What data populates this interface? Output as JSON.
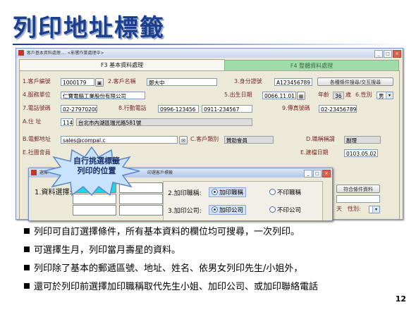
{
  "slide": {
    "title": "列印地址標籤",
    "page_number": "12",
    "bullets": [
      "列印可自訂選擇條件，所有基本資料的欄位均可搜尋，一次列印。",
      "可選擇生月，列印當月壽星的資料。",
      "列印除了基本的郵遞區號、地址、姓名、依男女列印先生/小姐外，",
      "還可於列印前選擇加印職稱取代先生小姐、加印公司、或加印聯絡電話"
    ],
    "callout": {
      "line1": "自行挑選標籤",
      "line2": "列印的位置"
    },
    "colors": {
      "title": "#1b3f8f",
      "tab2_bg": "#9fdca9"
    }
  },
  "main_window": {
    "title": "客戶基本資料處理.... <影響作業處理中>",
    "tab1": "F3 基本資料處理",
    "tab2": "F4 整體資料處理",
    "fields": {
      "cust_no_label": "1.客戶編號",
      "cust_no": "1000179",
      "cust_name_label": "2.客戶名稱",
      "cust_name": "鄭大中",
      "id_label": "3.身分證號",
      "id": "A123456789",
      "search_btn": "各種條件搜尋/交互搜尋",
      "company_label": "4.服務單位",
      "company": "仁寶電腦工業股份有限公司",
      "birth_label": "5.出生日期",
      "birth": "0066.11.01",
      "age_label": "年齡",
      "age": "36",
      "age_unit": "歲",
      "gender_label": "6.性別",
      "gender": "男",
      "phone_label": "7.電話號碼",
      "phone": "02-27970200",
      "mobile_label": "8.行動電話",
      "mobile": "0996-123456",
      "mobile2": "0911-234567",
      "fax_label": "9.傳真號碼",
      "fax": "02-23456789",
      "addr_label": "A.住 址",
      "zip": "114",
      "addr": "台北市內湖區瑞光路581號",
      "email_label": "B.電郵地址",
      "email": "sales@compal.c",
      "type_label": "C.客戶類別",
      "type": "贊助會員",
      "title_label": "D.職稱稱謂",
      "title_val": "副理",
      "social_label": "E.社團會員",
      "created_label": "E.建檔日期",
      "created": "0103.05.02"
    }
  },
  "dialog": {
    "title_left": "選擇",
    "title_right": "印選客戶標籤",
    "select_label": "1.資料選擇:",
    "opt1_label": "2.加印職稱:",
    "opt1_yes": "加印職稱",
    "opt1_no": "不印職稱",
    "opt2_label": "3.加印公司:",
    "opt2_yes": "加印公司",
    "opt2_no": "不印公司"
  },
  "side_panel": {
    "btn": "符合條件資料",
    "label_a": "天",
    "label_b": "性別:"
  }
}
